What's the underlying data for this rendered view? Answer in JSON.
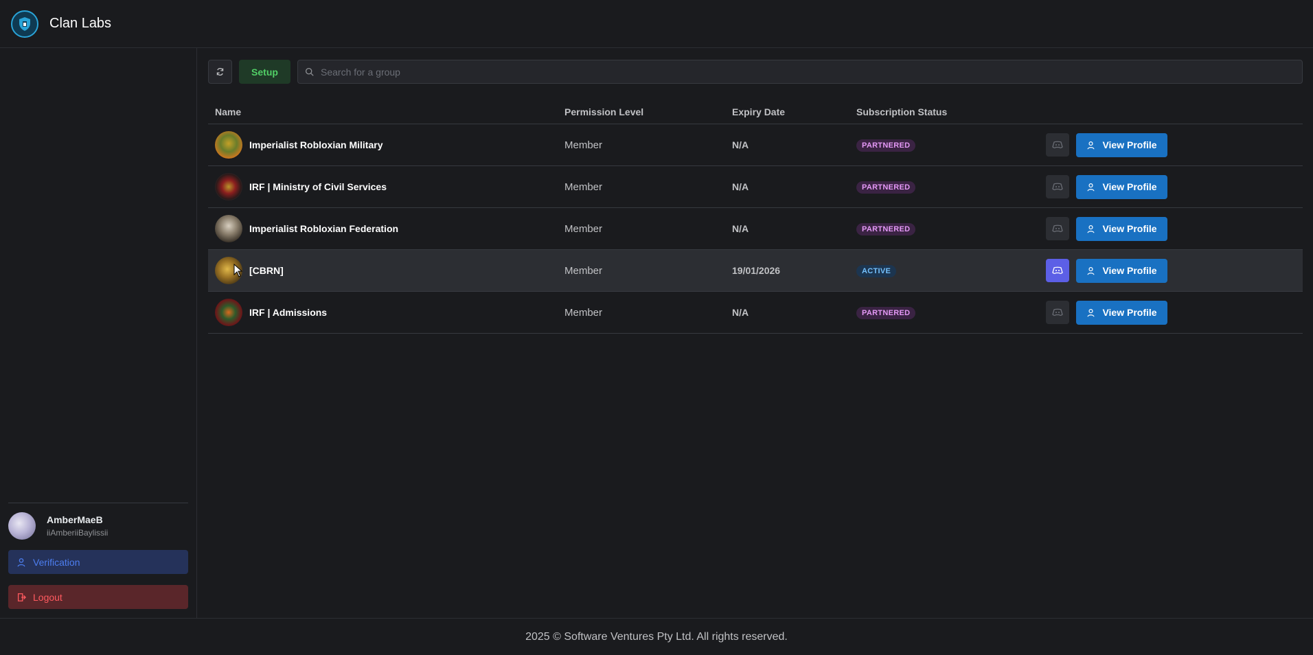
{
  "app": {
    "title": "Clan Labs"
  },
  "toolbar": {
    "setup_label": "Setup",
    "search_placeholder": "Search for a group"
  },
  "table": {
    "headers": {
      "name": "Name",
      "permission": "Permission Level",
      "expiry": "Expiry Date",
      "subscription": "Subscription Status"
    },
    "rows": [
      {
        "name": "Imperialist Robloxian Military",
        "permission": "Member",
        "expiry": "N/A",
        "status": "PARTNERED",
        "view_label": "View Profile"
      },
      {
        "name": "IRF | Ministry of Civil Services",
        "permission": "Member",
        "expiry": "N/A",
        "status": "PARTNERED",
        "view_label": "View Profile"
      },
      {
        "name": "Imperialist Robloxian Federation",
        "permission": "Member",
        "expiry": "N/A",
        "status": "PARTNERED",
        "view_label": "View Profile"
      },
      {
        "name": "[CBRN]",
        "permission": "Member",
        "expiry": "19/01/2026",
        "status": "ACTIVE",
        "view_label": "View Profile"
      },
      {
        "name": "IRF | Admissions",
        "permission": "Member",
        "expiry": "N/A",
        "status": "PARTNERED",
        "view_label": "View Profile"
      }
    ]
  },
  "sidebar": {
    "user": {
      "display_name": "AmberMaeB",
      "username": "iiAmberiiBaylissii"
    },
    "verification_label": "Verification",
    "logout_label": "Logout"
  },
  "footer": {
    "text": "2025 © Software Ventures Pty Ltd. All rights reserved."
  },
  "colors": {
    "background": "#1a1b1e",
    "primary": "#1971c2",
    "discord": "#5c5fe6",
    "partnered": "#e599f7",
    "active": "#74c0fc",
    "setup": "#51cf66",
    "logout": "#ff5a5f"
  }
}
